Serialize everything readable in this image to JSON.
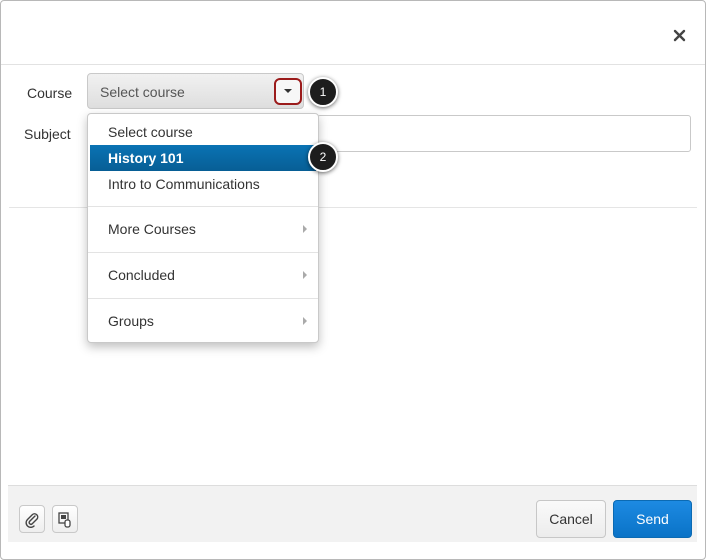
{
  "dialog": {
    "close_icon": "close-icon",
    "course_label": "Course",
    "subject_label": "Subject",
    "course_select": {
      "value": "Select course"
    },
    "subject_input": {
      "value": ""
    }
  },
  "dropdown": {
    "items": [
      {
        "label": "Select course",
        "highlighted": false,
        "submenu": false
      },
      {
        "label": "History 101",
        "highlighted": true,
        "submenu": false
      },
      {
        "label": "Intro to Communications",
        "highlighted": false,
        "submenu": false
      },
      {
        "label": "More Courses",
        "highlighted": false,
        "submenu": true
      },
      {
        "label": "Concluded",
        "highlighted": false,
        "submenu": true
      },
      {
        "label": "Groups",
        "highlighted": false,
        "submenu": true
      }
    ]
  },
  "callouts": {
    "step1": "1",
    "step2": "2"
  },
  "footer": {
    "attach_icon": "paperclip-icon",
    "media_icon": "media-record-icon",
    "cancel_label": "Cancel",
    "send_label": "Send"
  },
  "colors": {
    "highlight": "#0a6aa8",
    "send_button": "#1479d1",
    "callout_outline": "#9b1b1b"
  }
}
